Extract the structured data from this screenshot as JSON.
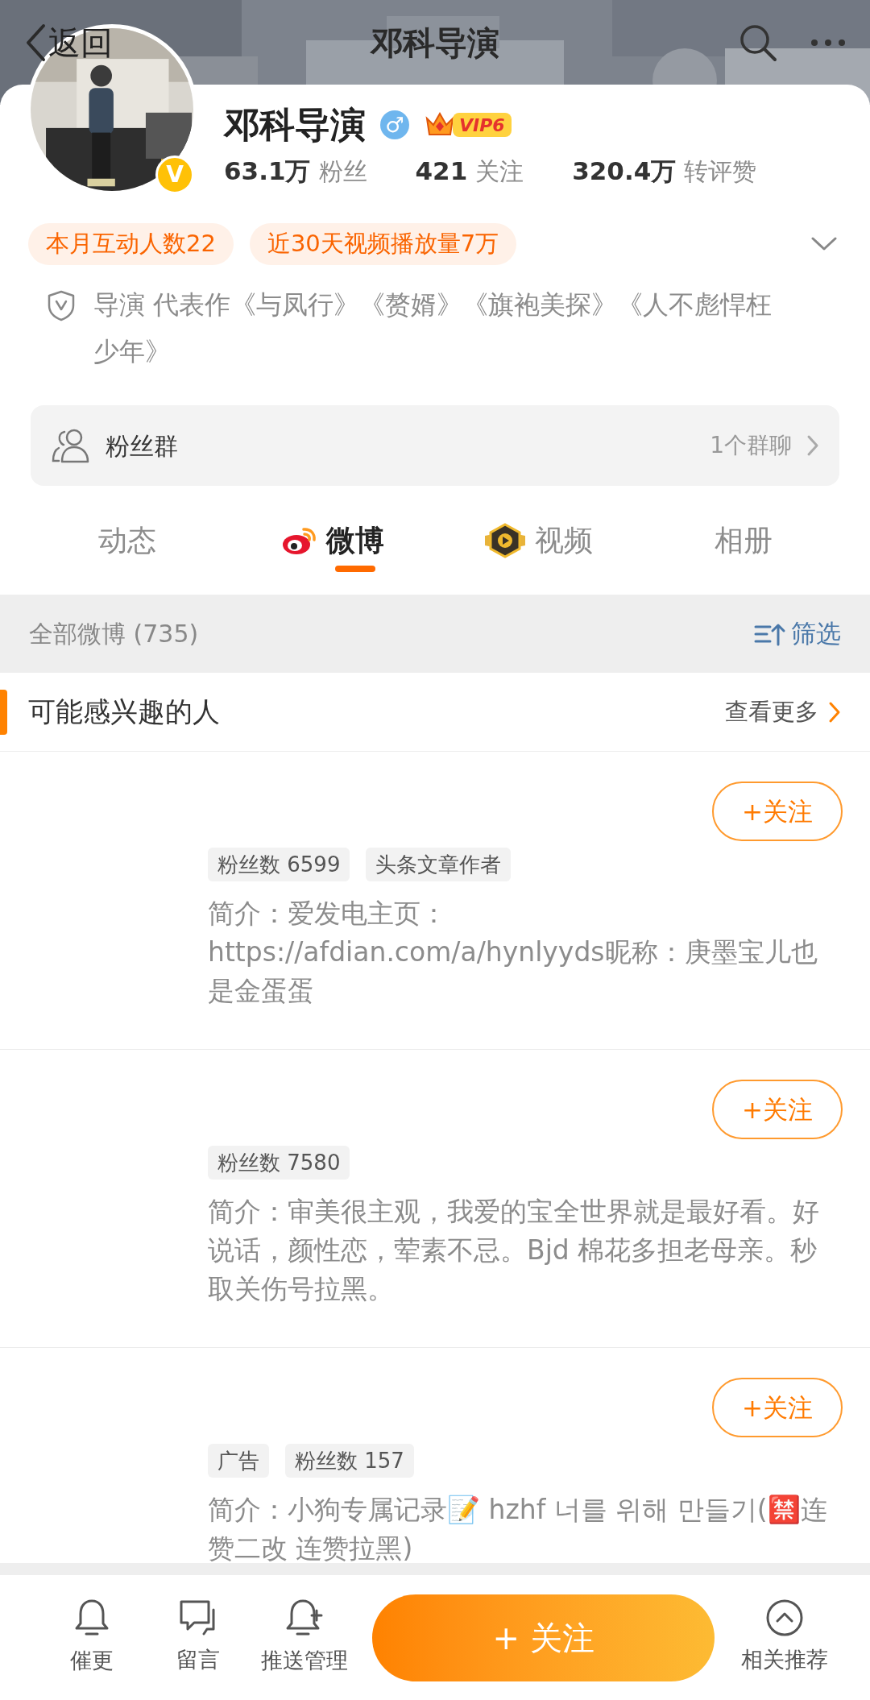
{
  "header": {
    "back": "返回",
    "title": "邓科导演"
  },
  "profile": {
    "verified_mark": "V",
    "name": "邓科导演",
    "gender_mark": "♂",
    "vip": "VIP6",
    "stats": [
      {
        "value": "63.1万",
        "label": "粉丝"
      },
      {
        "value": "421",
        "label": "关注"
      },
      {
        "value": "320.4万",
        "label": "转评赞"
      }
    ],
    "tags": [
      "本月互动人数22",
      "近30天视频播放量7万"
    ],
    "bio": "导演 代表作《与凤行》《赘婿》《旗袍美探》《人不彪悍枉少年》",
    "fan_group": {
      "label": "粉丝群",
      "count": "1个群聊"
    }
  },
  "tabs": [
    {
      "label": "动态",
      "kind": "plain",
      "selected": false
    },
    {
      "label": "微博",
      "kind": "weibo",
      "selected": true
    },
    {
      "label": "视频",
      "kind": "video",
      "selected": false
    },
    {
      "label": "相册",
      "kind": "plain",
      "selected": false
    }
  ],
  "feed_bar": {
    "title": "全部微博 (735)",
    "filter": "筛选"
  },
  "suggestions": {
    "title": "可能感兴趣的人",
    "more": "查看更多",
    "people": [
      {
        "tags": [
          "粉丝数 6599",
          "头条文章作者"
        ],
        "intro": "简介：爱发电主页：https://afdian.com/a/hynlyyds昵称：庚墨宝儿也是金蛋蛋",
        "follow": "+关注"
      },
      {
        "tags": [
          "粉丝数 7580"
        ],
        "intro": "简介：审美很主观，我爱的宝全世界就是最好看。好说话，颜性恋，荤素不忌。Bjd 棉花多担老母亲。秒取关伤号拉黑。",
        "follow": "+关注"
      },
      {
        "tags": [
          "广告",
          "粉丝数 157"
        ],
        "intro": "简介：小狗专属记录📝 hzhf 너를 위해 만들기(🈲连赞二改 连赞拉黑)",
        "follow": "+关注"
      }
    ]
  },
  "bottom_bar": {
    "actions": [
      {
        "label": "催更",
        "kind": "bell"
      },
      {
        "label": "留言",
        "kind": "chat"
      },
      {
        "label": "推送管理",
        "kind": "bell_plus"
      }
    ],
    "follow": "+ 关注",
    "related": {
      "label": "相关推荐",
      "kind": "up"
    }
  }
}
